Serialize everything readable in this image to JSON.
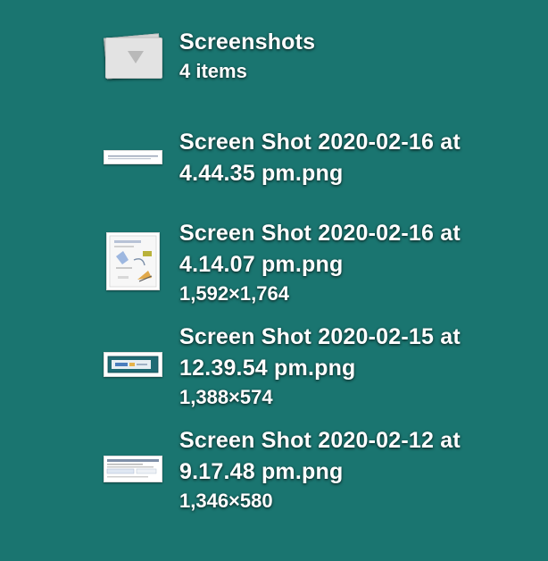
{
  "stack": {
    "title": "Screenshots",
    "subtitle": "4 items",
    "icon": "folder-stack-icon"
  },
  "files": [
    {
      "name_line1": "Screen Shot 2020-02-16 at",
      "name_line2": "4.44.35 pm.png",
      "dimensions": ""
    },
    {
      "name_line1": "Screen Shot 2020-02-16 at",
      "name_line2": "4.14.07 pm.png",
      "dimensions": "1,592×1,764"
    },
    {
      "name_line1": "Screen Shot 2020-02-15 at",
      "name_line2": "12.39.54 pm.png",
      "dimensions": "1,388×574"
    },
    {
      "name_line1": "Screen Shot 2020-02-12 at",
      "name_line2": "9.17.48 pm.png",
      "dimensions": "1,346×580"
    }
  ],
  "colors": {
    "background": "#1a7570",
    "text": "#ffffff"
  }
}
